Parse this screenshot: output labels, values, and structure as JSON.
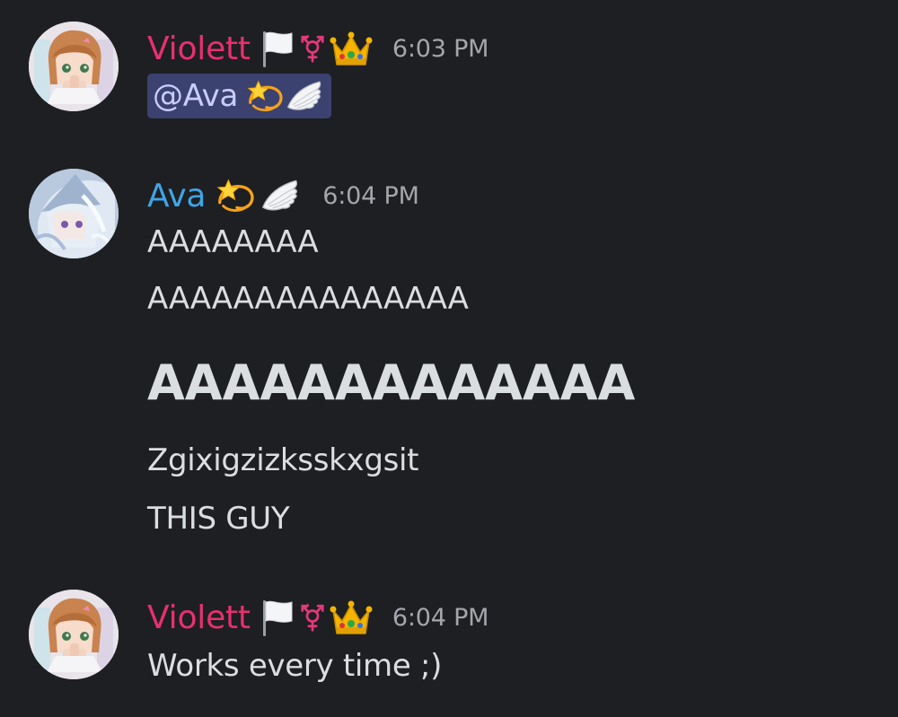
{
  "colors": {
    "background": "#1e1f22",
    "violett_name": "#e8306e",
    "ava_name": "#3fa5e6",
    "timestamp": "#a3a6ab",
    "message_text": "#dbdee1",
    "mention_bg": "#3c4270",
    "mention_text": "#c9cdfb"
  },
  "messages": [
    {
      "author": "Violett",
      "badges": [
        "white-flag-icon",
        "transgender-symbol-icon",
        "crown-icon"
      ],
      "timestamp": "6:03 PM",
      "mention": "@Ava",
      "mention_badges": [
        "dizzy-star-icon",
        "angel-wing-icon"
      ]
    },
    {
      "author": "Ava",
      "badges": [
        "dizzy-star-icon",
        "angel-wing-icon"
      ],
      "timestamp": "6:04 PM",
      "lines": [
        "AAAAAAAA",
        "AAAAAAAAAAAAAAA",
        "AAAAAAAAAAAAA",
        "Zgixigzizksskxgsit",
        "THIS GUY"
      ]
    },
    {
      "author": "Violett",
      "badges": [
        "white-flag-icon",
        "transgender-symbol-icon",
        "crown-icon"
      ],
      "timestamp": "6:04 PM",
      "lines": [
        "Works every time ;)"
      ]
    }
  ]
}
